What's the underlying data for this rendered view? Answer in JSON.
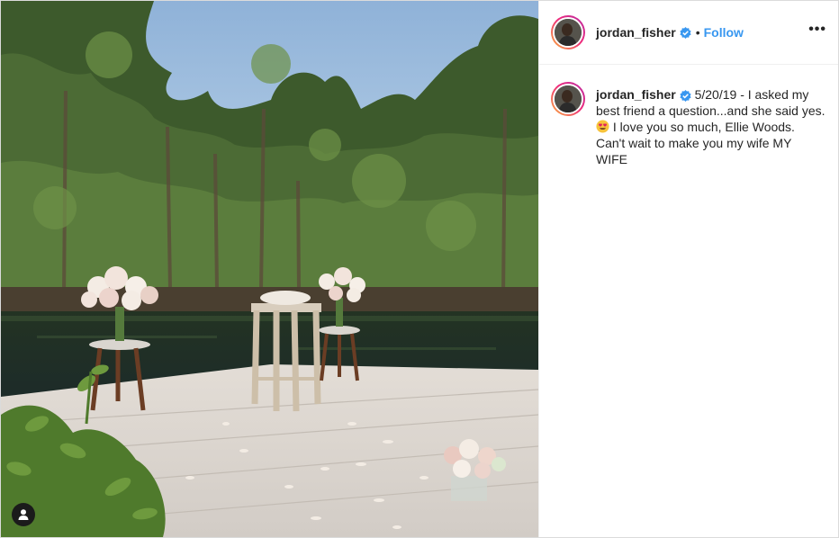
{
  "post": {
    "username": "jordan_fisher",
    "separator": "•",
    "follow_label": "Follow",
    "more_label": "•••",
    "caption": {
      "username": "jordan_fisher",
      "text_before_emoji": " 5/20/19 - I asked my best friend a question...and she said yes. ",
      "emoji": "heart-eyes-emoji",
      "text_after_emoji": " I love you so much, Ellie Woods. Can't wait to make you my wife MY WIFE"
    }
  },
  "icons": {
    "verified": "verified-badge-icon",
    "user_tag": "user-tag-icon",
    "more": "more-options-icon"
  },
  "colors": {
    "accent": "#3897f0",
    "text": "#262626",
    "border": "#dbdbdb"
  }
}
